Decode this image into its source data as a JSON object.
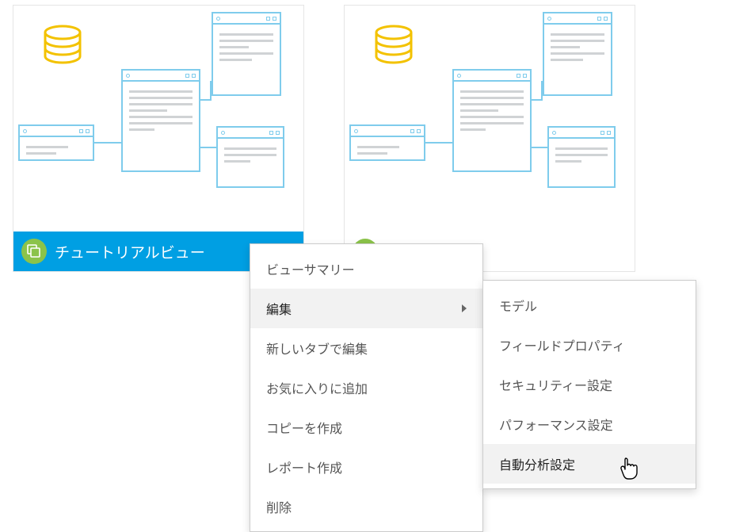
{
  "cards": {
    "card1": {
      "title": "チュートリアルビュー"
    },
    "card2": {
      "title": ""
    }
  },
  "contextMenu": {
    "items": [
      {
        "label": "ビューサマリー"
      },
      {
        "label": "編集"
      },
      {
        "label": "新しいタブで編集"
      },
      {
        "label": "お気に入りに追加"
      },
      {
        "label": "コピーを作成"
      },
      {
        "label": "レポート作成"
      },
      {
        "label": "削除"
      }
    ]
  },
  "editSubmenu": {
    "items": [
      {
        "label": "モデル"
      },
      {
        "label": "フィールドプロパティ"
      },
      {
        "label": "セキュリティー設定"
      },
      {
        "label": "パフォーマンス設定"
      },
      {
        "label": "自動分析設定"
      }
    ]
  },
  "colors": {
    "accent": "#009fe3",
    "iconBg": "#8bc34a",
    "diagramStroke": "#7fccec",
    "dbColor": "#f9c80e"
  }
}
